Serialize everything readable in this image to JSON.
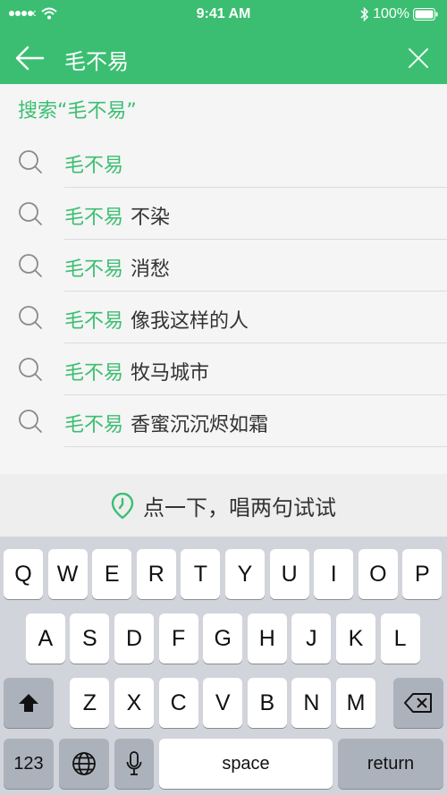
{
  "status": {
    "time": "9:41 AM",
    "battery": "100%"
  },
  "search": {
    "query": "毛不易"
  },
  "prompt": {
    "label": "搜索“毛不易”"
  },
  "suggestions": [
    {
      "highlight": "毛不易",
      "rest": ""
    },
    {
      "highlight": "毛不易",
      "rest": "不染"
    },
    {
      "highlight": "毛不易",
      "rest": "消愁"
    },
    {
      "highlight": "毛不易",
      "rest": "像我这样的人"
    },
    {
      "highlight": "毛不易",
      "rest": "牧马城市"
    },
    {
      "highlight": "毛不易",
      "rest": "香蜜沉沉烬如霜"
    }
  ],
  "hum": {
    "label": "点一下，唱两句试试"
  },
  "keyboard": {
    "row1": [
      "Q",
      "W",
      "E",
      "R",
      "T",
      "Y",
      "U",
      "I",
      "O",
      "P"
    ],
    "row2": [
      "A",
      "S",
      "D",
      "F",
      "G",
      "H",
      "J",
      "K",
      "L"
    ],
    "row3": [
      "Z",
      "X",
      "C",
      "V",
      "B",
      "N",
      "M"
    ],
    "numbers_label": "123",
    "space_label": "space",
    "return_label": "return"
  },
  "colors": {
    "accent": "#3cbe72",
    "keyboard_bg": "#d1d4da"
  }
}
